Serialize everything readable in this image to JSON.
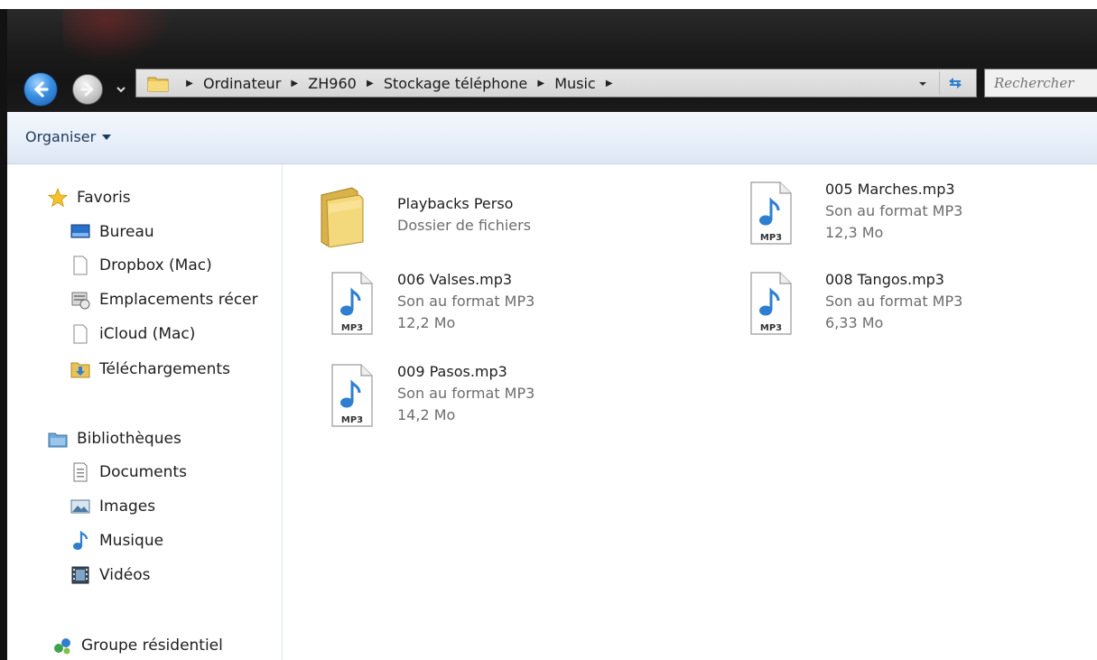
{
  "window": {
    "accent": "#1a5cb0"
  },
  "breadcrumb": [
    "Ordinateur",
    "ZH960",
    "Stockage téléphone",
    "Music"
  ],
  "search": {
    "placeholder": "Rechercher"
  },
  "toolbar": {
    "organise_label": "Organiser"
  },
  "sidebar": {
    "favorites_label": "Favoris",
    "favorites": [
      "Bureau",
      "Dropbox (Mac)",
      "Emplacements récer",
      "iCloud (Mac)",
      "Téléchargements"
    ],
    "libraries_label": "Bibliothèques",
    "libraries": [
      "Documents",
      "Images",
      "Musique",
      "Vidéos"
    ],
    "homegroup_label": "Groupe résidentiel"
  },
  "files": [
    {
      "name": "Playbacks Perso",
      "type": "Dossier de fichiers",
      "size": "",
      "icon": "folder-icon"
    },
    {
      "name": "005 Marches.mp3",
      "type": "Son au format MP3",
      "size": "12,3 Mo",
      "icon": "mp3-file-icon"
    },
    {
      "name": "006 Valses.mp3",
      "type": "Son au format MP3",
      "size": "12,2 Mo",
      "icon": "mp3-file-icon"
    },
    {
      "name": "008 Tangos.mp3",
      "type": "Son au format MP3",
      "size": "6,33 Mo",
      "icon": "mp3-file-icon"
    },
    {
      "name": "009 Pasos.mp3",
      "type": "Son au format MP3",
      "size": "14,2 Mo",
      "icon": "mp3-file-icon"
    }
  ],
  "mp3_badge": "MP3"
}
